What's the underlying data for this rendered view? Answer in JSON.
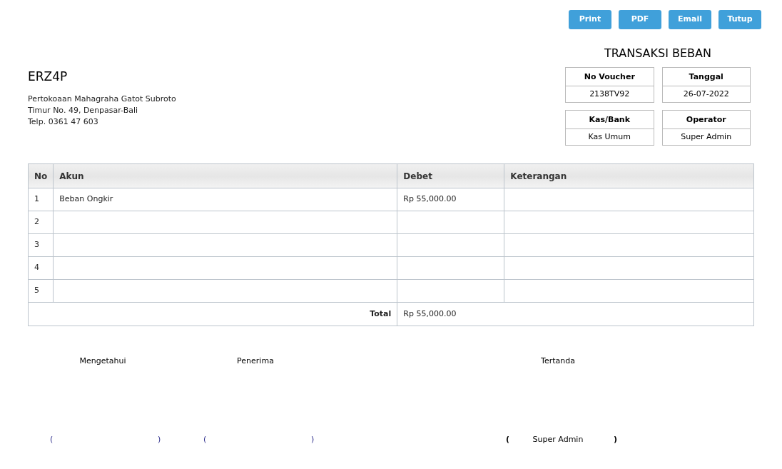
{
  "buttons": [
    "Print",
    "PDF",
    "Email",
    "Tutup"
  ],
  "title": "TRANSAKSI BEBAN",
  "company": {
    "name": "ERZ4P",
    "address_lines": [
      "Pertokoaan Mahagraha Gatot Subroto",
      "Timur No. 49, Denpasar-Bali",
      "Telp. 0361 47 603"
    ]
  },
  "info": [
    {
      "label": "No Voucher",
      "value": "2138TV92"
    },
    {
      "label": "Tanggal",
      "value": "26-07-2022"
    },
    {
      "label": "Kas/Bank",
      "value": "Kas Umum"
    },
    {
      "label": "Operator",
      "value": "Super Admin"
    }
  ],
  "table": {
    "columns": [
      "No",
      "Akun",
      "Debet",
      "Keterangan"
    ],
    "rows": [
      [
        "1",
        "Beban Ongkir",
        "Rp 55,000.00",
        ""
      ],
      [
        "2",
        "",
        "",
        ""
      ],
      [
        "3",
        "",
        "",
        ""
      ],
      [
        "4",
        "",
        "",
        ""
      ],
      [
        "5",
        "",
        "",
        ""
      ]
    ],
    "total": {
      "label": "Total",
      "value": "Rp 55,000.00"
    }
  },
  "signatures": [
    {
      "kind": "blank",
      "label": "Mengetahui",
      "open": "(",
      "close": ")"
    },
    {
      "kind": "blank",
      "label": "Penerima",
      "open": "(",
      "close": ")"
    },
    {
      "kind": "signed",
      "label": "Tertanda",
      "open": "(",
      "name": "Super Admin",
      "close": ")"
    }
  ]
}
